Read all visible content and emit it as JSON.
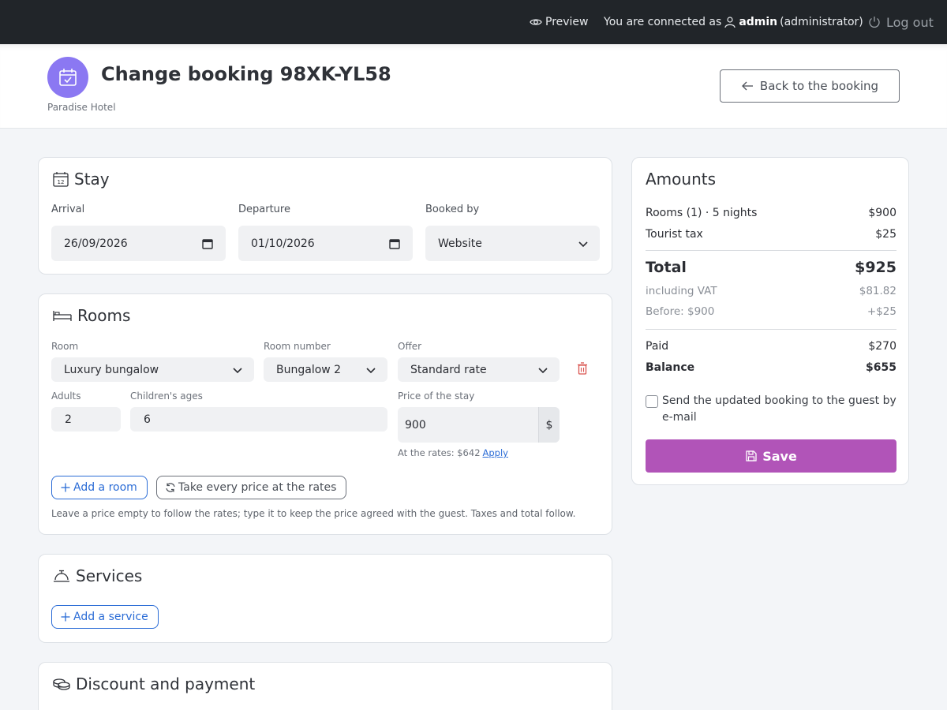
{
  "topbar": {
    "preview_label": "Preview",
    "connected_prefix": "You are connected as",
    "username": "admin",
    "role": "(administrator)",
    "logout_label": "Log out"
  },
  "header": {
    "title": "Change booking 98XK-YL58",
    "hotel_name": "Paradise Hotel",
    "back_label": "Back to the booking"
  },
  "stay": {
    "title": "Stay",
    "arrival_label": "Arrival",
    "arrival_value": "26/09/2026",
    "departure_label": "Departure",
    "departure_value": "01/10/2026",
    "booked_by_label": "Booked by",
    "booked_by_value": "Website"
  },
  "rooms": {
    "title": "Rooms",
    "room_label": "Room",
    "room_value": "Luxury bungalow",
    "room_number_label": "Room number",
    "room_number_value": "Bungalow 2",
    "offer_label": "Offer",
    "offer_value": "Standard rate",
    "adults_label": "Adults",
    "adults_value": "2",
    "children_label": "Children's ages",
    "children_value": "6",
    "price_label": "Price of the stay",
    "price_value": "900",
    "currency": "$",
    "rates_hint": "At the rates: $642",
    "apply_label": "Apply",
    "add_room_label": "Add a room",
    "take_rates_label": "Take every price at the rates",
    "help_text": "Leave a price empty to follow the rates; type it to keep the price agreed with the guest. Taxes and total follow."
  },
  "services": {
    "title": "Services",
    "add_service_label": "Add a service"
  },
  "discount": {
    "title": "Discount and payment"
  },
  "amounts": {
    "title": "Amounts",
    "rooms_label": "Rooms (1) · 5 nights",
    "rooms_value": "$900",
    "tax_label": "Tourist tax",
    "tax_value": "$25",
    "total_label": "Total",
    "total_value": "$925",
    "vat_label": "including VAT",
    "vat_value": "$81.82",
    "before_label": "Before: $900",
    "before_value": "+$25",
    "paid_label": "Paid",
    "paid_value": "$270",
    "balance_label": "Balance",
    "balance_value": "$655",
    "email_label": "Send the updated booking to the guest by e-mail",
    "save_label": "Save"
  },
  "colors": {
    "topbar": "#212529",
    "brand": "#8b78f2",
    "save": "#b154b8",
    "link": "#2b6cd6",
    "trash": "#d9534f"
  }
}
